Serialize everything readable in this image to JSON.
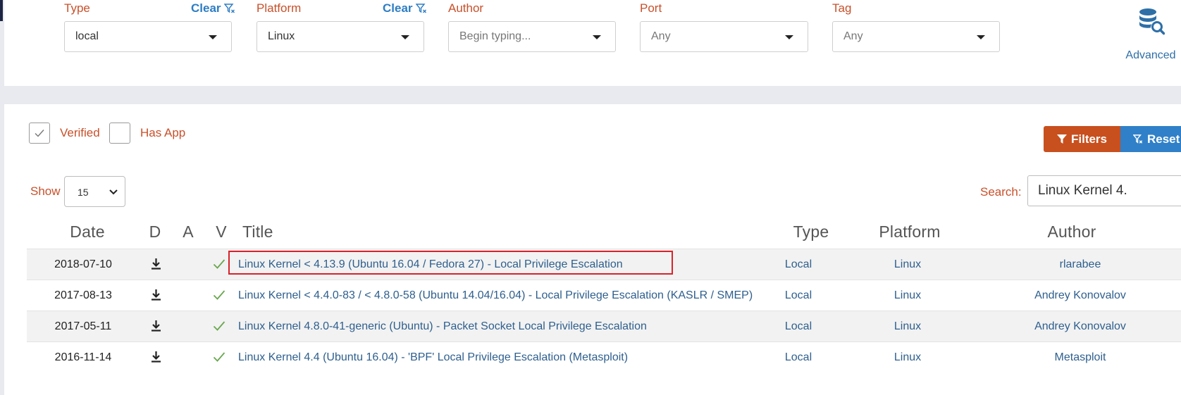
{
  "filters": [
    {
      "label": "Type",
      "value": "local",
      "clear_label": "Clear",
      "has_clear": true,
      "muted": false
    },
    {
      "label": "Platform",
      "value": "Linux",
      "clear_label": "Clear",
      "has_clear": true,
      "muted": false
    },
    {
      "label": "Author",
      "value": "Begin typing...",
      "has_clear": false,
      "muted": true
    },
    {
      "label": "Port",
      "value": "Any",
      "has_clear": false,
      "muted": true
    },
    {
      "label": "Tag",
      "value": "Any",
      "has_clear": false,
      "muted": true
    }
  ],
  "advanced": {
    "label": "Advanced",
    "icon": "database-search-icon"
  },
  "checkboxes": {
    "verified": {
      "label": "Verified",
      "checked": true
    },
    "has_app": {
      "label": "Has App",
      "checked": false
    }
  },
  "buttons": {
    "filters": "Filters",
    "reset": "Reset"
  },
  "show": {
    "label": "Show",
    "value": "15"
  },
  "search": {
    "label": "Search:",
    "value": "Linux Kernel 4."
  },
  "table": {
    "headers": {
      "date": "Date",
      "d": "D",
      "a": "A",
      "v": "V",
      "title": "Title",
      "type": "Type",
      "platform": "Platform",
      "author": "Author"
    },
    "rows": [
      {
        "date": "2018-07-10",
        "title": "Linux Kernel < 4.13.9 (Ubuntu 16.04 / Fedora 27) - Local Privilege Escalation",
        "type": "Local",
        "platform": "Linux",
        "author": "rlarabee",
        "verified": true,
        "highlighted": true
      },
      {
        "date": "2017-08-13",
        "title": "Linux Kernel < 4.4.0-83 / < 4.8.0-58 (Ubuntu 14.04/16.04) - Local Privilege Escalation (KASLR / SMEP)",
        "type": "Local",
        "platform": "Linux",
        "author": "Andrey Konovalov",
        "verified": true,
        "highlighted": false
      },
      {
        "date": "2017-05-11",
        "title": "Linux Kernel 4.8.0-41-generic (Ubuntu) - Packet Socket Local Privilege Escalation",
        "type": "Local",
        "platform": "Linux",
        "author": "Andrey Konovalov",
        "verified": true,
        "highlighted": false
      },
      {
        "date": "2016-11-14",
        "title": "Linux Kernel 4.4 (Ubuntu 16.04) - 'BPF' Local Privilege Escalation (Metasploit)",
        "type": "Local",
        "platform": "Linux",
        "author": "Metasploit",
        "verified": true,
        "highlighted": false
      }
    ]
  },
  "colors": {
    "accent": "#c8502a",
    "link": "#2e5f8e",
    "clear": "#2e7dc4",
    "filters_btn": "#c8501e",
    "reset_btn": "#2f80c8",
    "check": "#6aa84f",
    "highlight": "#d8232a"
  }
}
